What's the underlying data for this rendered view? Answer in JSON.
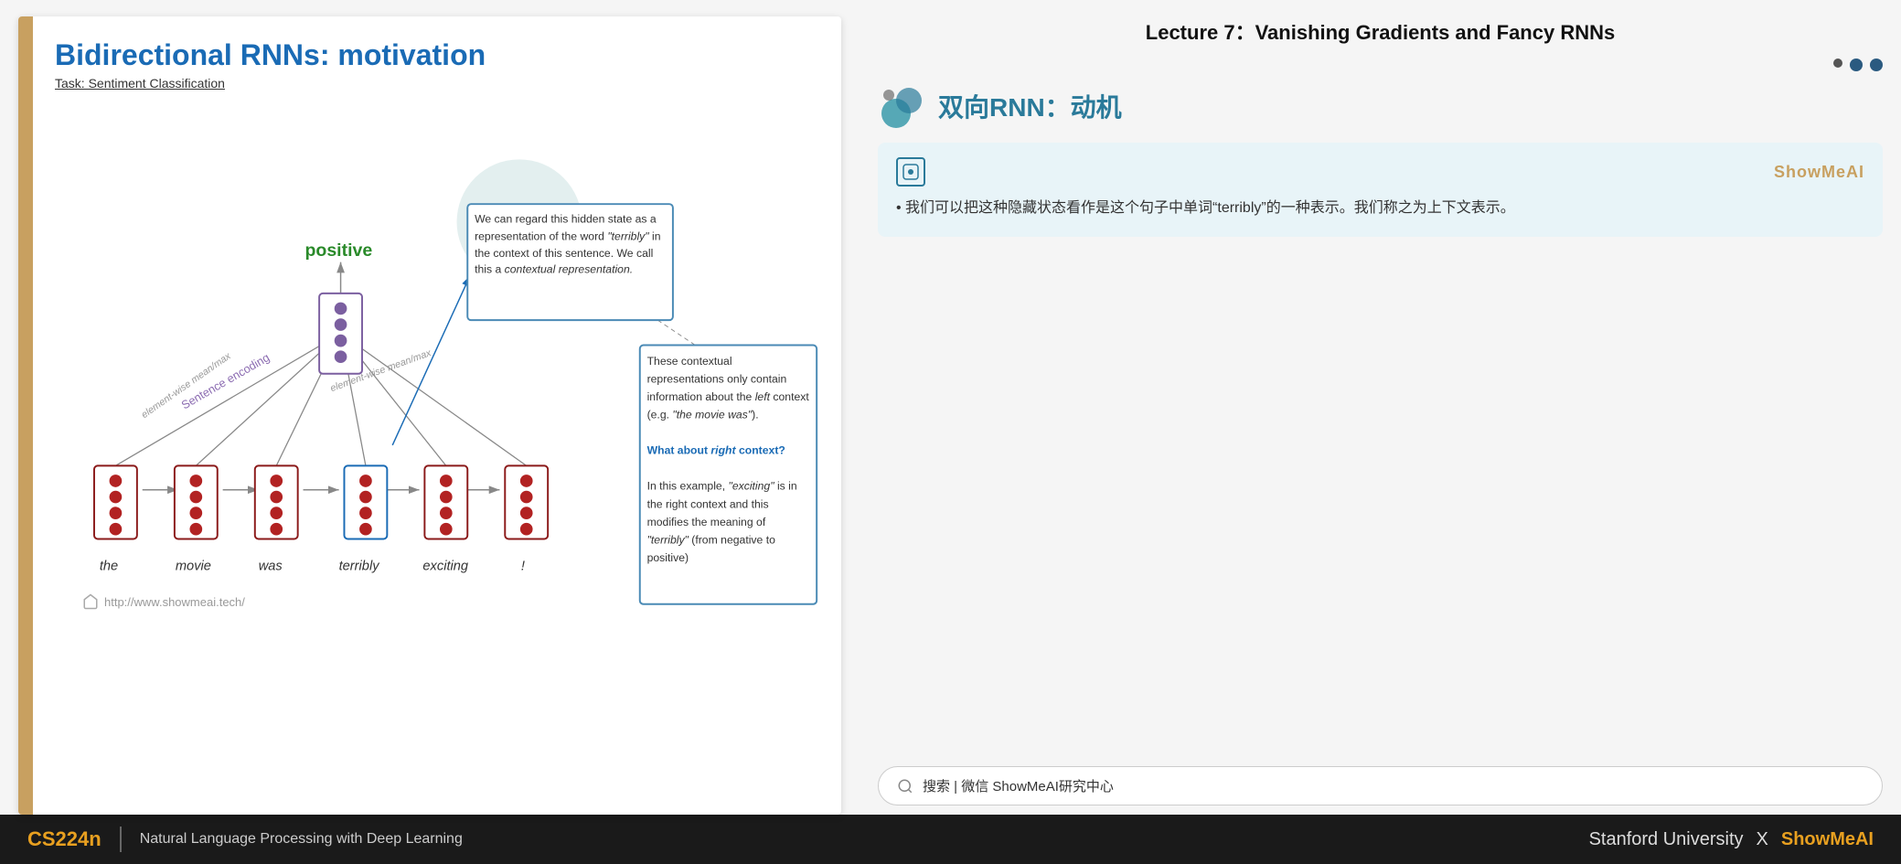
{
  "lecture": {
    "title": "Lecture 7：Vanishing Gradients and Fancy RNNs"
  },
  "slide": {
    "title": "Bidirectional RNNs: motivation",
    "subtitle": "Task: Sentiment Classification",
    "positive_label": "positive",
    "sentence_encoding_label": "Sentence encoding",
    "element_wise_label1": "element-wise mean/max",
    "element_wise_label2": "element-wise mean/max",
    "words": [
      "the",
      "movie",
      "was",
      "terribly",
      "exciting",
      "!"
    ],
    "annotation1": {
      "text1": "We can regard this hidden state as a",
      "text2": "representation of the word ",
      "italicText2": "“terribly”",
      "text3": " in the",
      "text4": "context of this sentence. We call this a",
      "italicText4": "contextual representation."
    },
    "annotation2": {
      "text1": "These contextual",
      "text2": "representations only",
      "text3": "contain information",
      "text4": "about the ",
      "italic_left": "left",
      "text5": " context",
      "text6": "(e.g. ",
      "italic_movie": "“the movie",
      "text7": "was”",
      "text8": ").",
      "bold_what": "What about ",
      "bold_right": "right",
      "bold_context": "context?",
      "text9": "In this example,",
      "italic_exciting": "“exciting”",
      "text10": " is in the",
      "text11": "right context and this",
      "text12": "modifies the meaning",
      "text13": "of ",
      "italic_terribly": "“terribly”",
      "text14": " (from",
      "text15": "negative to positive)"
    },
    "url": "http://www.showmeai.tech/"
  },
  "chinese_section": {
    "title": "双向RNN：动机",
    "showmeai_brand": "ShowMeAI",
    "bullet_text": "• 我们可以把这种隐藏状态看作是这个句子中单词“terribly”的一种表示。我们称之为上下文表示。"
  },
  "nav_dots": [
    "dot1",
    "dot2",
    "dot3"
  ],
  "search_bar": {
    "text": "搜索 | 微信 ShowMeAI研究中心"
  },
  "bottom_bar": {
    "course_code": "CS224n",
    "separator": "|",
    "course_name": "Natural Language Processing with Deep Learning",
    "university": "Stanford University",
    "x": "X",
    "brand": "ShowMeAI"
  }
}
